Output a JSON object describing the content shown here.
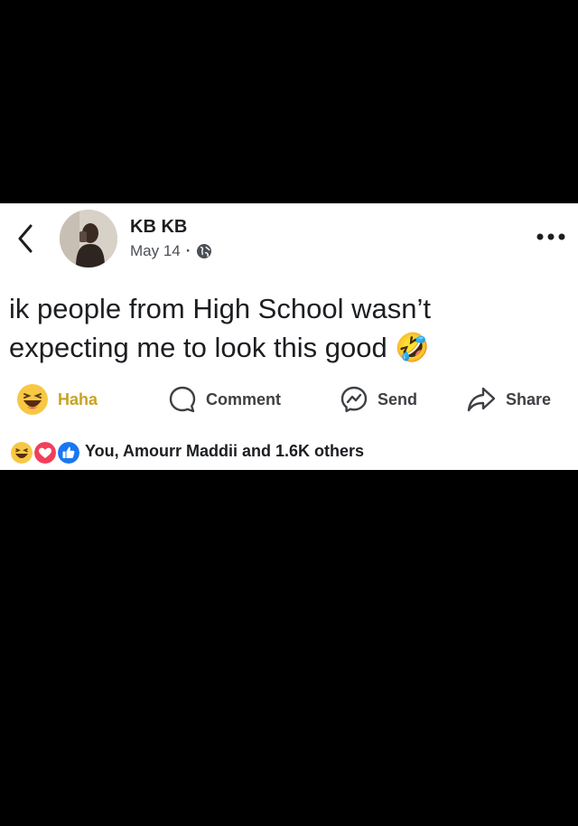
{
  "post": {
    "author": "KB KB",
    "date": "May 14",
    "separator": "·",
    "privacy_icon": "globe-icon",
    "text": "ik people from High School wasn’t expecting me to look this good",
    "text_emoji": "🤣"
  },
  "actions": {
    "haha_label": "Haha",
    "comment_label": "Comment",
    "send_label": "Send",
    "share_label": "Share"
  },
  "reactions": {
    "icons": [
      "haha-icon",
      "love-icon",
      "like-icon"
    ],
    "summary": "You, Amourr Maddii and 1.6K others"
  },
  "colors": {
    "haha_accent": "#c8a322",
    "like_blue": "#1877f2",
    "love_red": "#f33e58",
    "text_dark": "#1c1e21"
  }
}
